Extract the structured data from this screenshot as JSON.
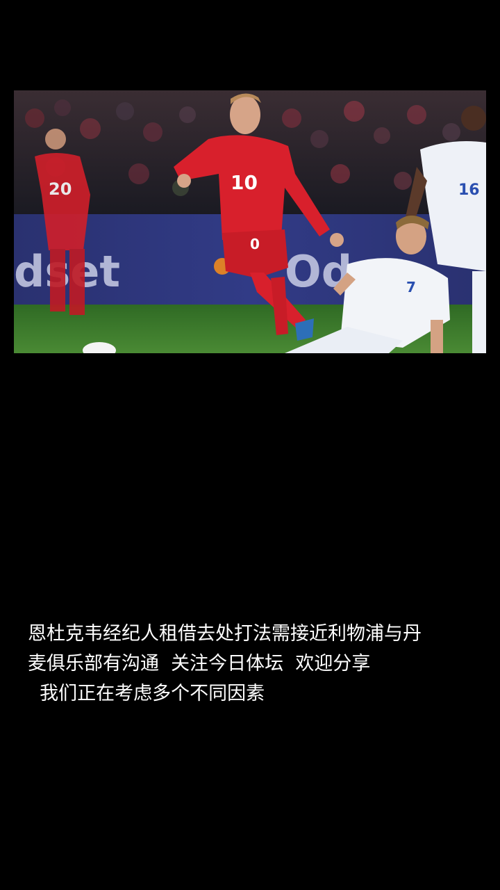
{
  "photo": {
    "ad_board_text_left": "dset",
    "ad_board_text_right": "Od",
    "player_main_number": "10",
    "player_main_short_number": "0",
    "player_left_number": "20",
    "player_right_number": "16",
    "player_slide_number": "7",
    "colors": {
      "red_kit": "#d8202c",
      "white_kit": "#f2f4f8",
      "ad_board": "#2b3479",
      "pitch": "#3d7a2e",
      "crowd": "#2a2226"
    }
  },
  "caption": {
    "line1": "恩杜克韦经纪人租借去处打法需接近利物浦与丹",
    "line2": "麦俱乐部有沟通  关注今日体坛  欢迎分享",
    "line3": "  我们正在考虑多个不同因素"
  }
}
